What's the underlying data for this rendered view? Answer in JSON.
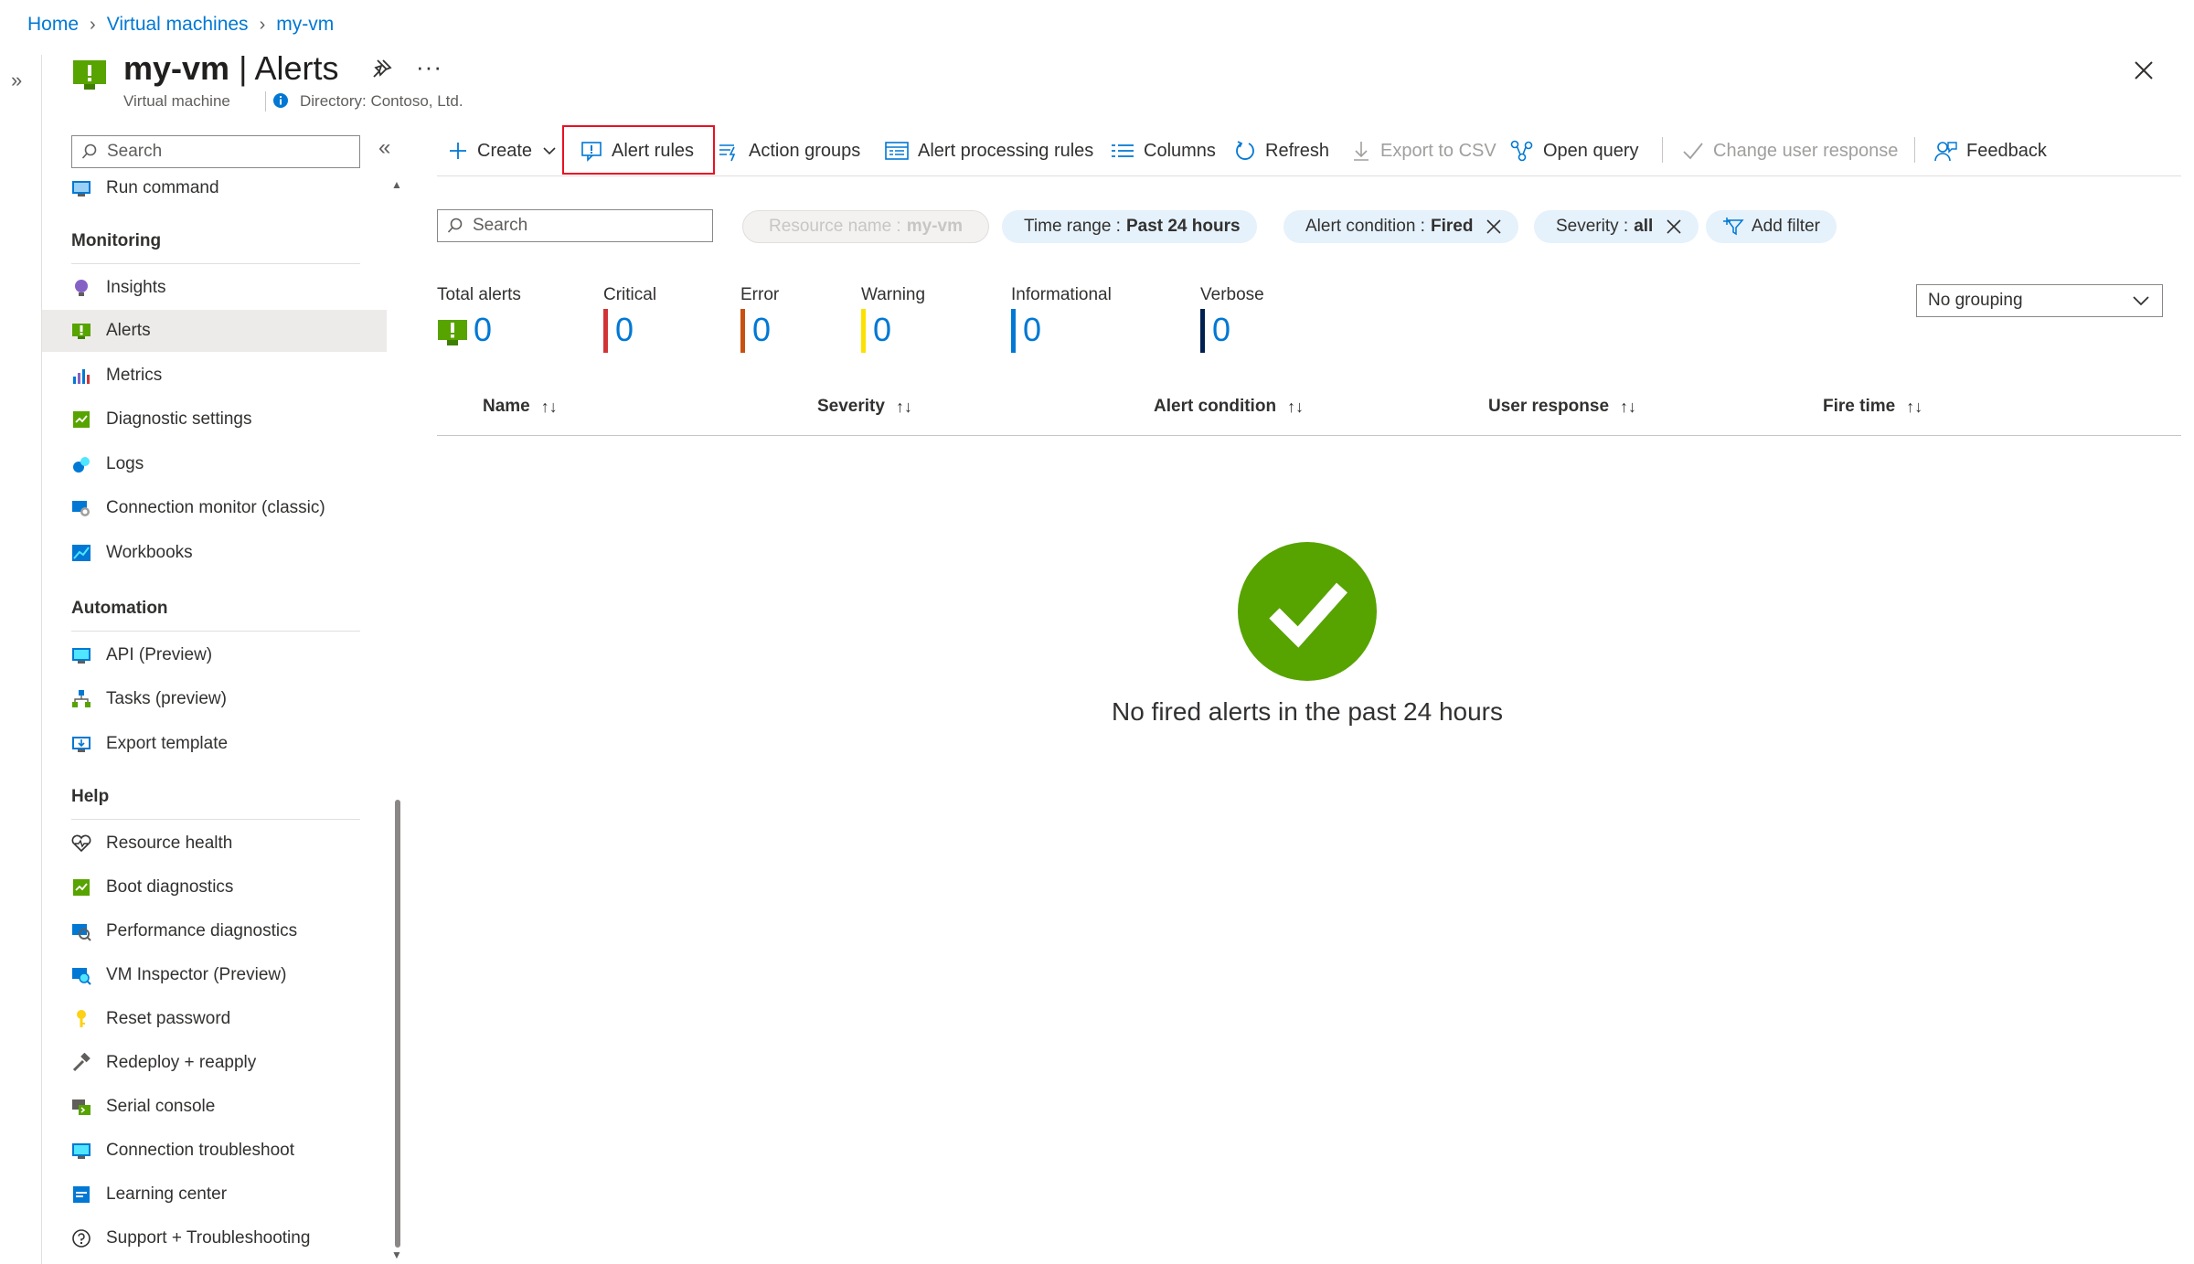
{
  "breadcrumb": [
    {
      "label": "Home"
    },
    {
      "label": "Virtual machines"
    },
    {
      "label": "my-vm"
    }
  ],
  "header": {
    "resource": "my-vm",
    "separator": "|",
    "page": "Alerts",
    "subtitle": "Virtual machine",
    "directory": "Directory: Contoso, Ltd.",
    "more": "···"
  },
  "sidebar": {
    "search_placeholder": "Search",
    "top_item": "Run command",
    "sections": [
      {
        "title": "Monitoring",
        "items": [
          "Insights",
          "Alerts",
          "Metrics",
          "Diagnostic settings",
          "Logs",
          "Connection monitor (classic)",
          "Workbooks"
        ]
      },
      {
        "title": "Automation",
        "items": [
          "API (Preview)",
          "Tasks (preview)",
          "Export template"
        ]
      },
      {
        "title": "Help",
        "items": [
          "Resource health",
          "Boot diagnostics",
          "Performance diagnostics",
          "VM Inspector (Preview)",
          "Reset password",
          "Redeploy + reapply",
          "Serial console",
          "Connection troubleshoot",
          "Learning center",
          "Support + Troubleshooting"
        ]
      }
    ],
    "active_item": "Alerts"
  },
  "toolbar": {
    "create": "Create",
    "alert_rules": "Alert rules",
    "action_groups": "Action groups",
    "alert_processing_rules": "Alert processing rules",
    "columns": "Columns",
    "refresh": "Refresh",
    "export_csv": "Export to CSV",
    "open_query": "Open query",
    "change_user_response": "Change user response",
    "feedback": "Feedback"
  },
  "filters": {
    "search_placeholder": "Search",
    "resource_name": {
      "label": "Resource name :",
      "value": "my-vm"
    },
    "time_range": {
      "label": "Time range :",
      "value": "Past 24 hours"
    },
    "alert_condition": {
      "label": "Alert condition :",
      "value": "Fired"
    },
    "severity": {
      "label": "Severity :",
      "value": "all"
    },
    "add_filter": "Add filter"
  },
  "summary": {
    "total": {
      "label": "Total alerts",
      "value": "0"
    },
    "critical": {
      "label": "Critical",
      "value": "0",
      "color": "#d13438"
    },
    "error": {
      "label": "Error",
      "value": "0",
      "color": "#ca5010"
    },
    "warning": {
      "label": "Warning",
      "value": "0",
      "color": "#fce100"
    },
    "informational": {
      "label": "Informational",
      "value": "0",
      "color": "#0078d4"
    },
    "verbose": {
      "label": "Verbose",
      "value": "0",
      "color": "#002050"
    }
  },
  "grouping": {
    "selected": "No grouping"
  },
  "table": {
    "columns": [
      "Name",
      "Severity",
      "Alert condition",
      "User response",
      "Fire time"
    ],
    "sort_glyph": "↑↓"
  },
  "empty_state": {
    "message": "No fired alerts in the past 24 hours"
  },
  "colors": {
    "accent": "#0078d4",
    "success": "#57a300",
    "highlight_box": "#e81123"
  }
}
